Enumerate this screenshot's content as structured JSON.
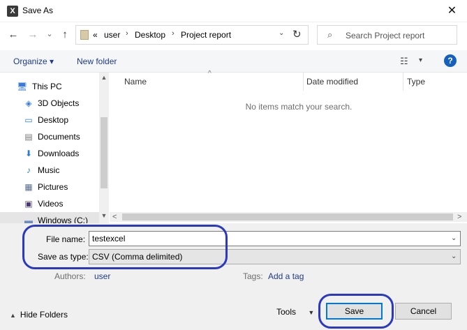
{
  "window": {
    "app_icon": "X",
    "title": "Save As",
    "close_glyph": "✕"
  },
  "nav": {
    "back": "←",
    "forward": "→",
    "recent": "⌄",
    "up": "↑",
    "address": {
      "overflow": "«",
      "segments": [
        "user",
        "Desktop",
        "Project report"
      ],
      "separator": "›",
      "dropdown": "⌄",
      "refresh": "↻"
    },
    "search_placeholder": "Search Project report",
    "search_glyph": "⌕"
  },
  "toolbar": {
    "organize": "Organize ▾",
    "new_folder": "New folder",
    "view_glyph": "☷",
    "view_dropdown": "▾",
    "help": "?"
  },
  "sidebar": {
    "items": [
      {
        "label": "This PC",
        "icon": "computer-icon",
        "glyph": "🖥",
        "indent": 0
      },
      {
        "label": "3D Objects",
        "icon": "cube-icon",
        "glyph": "◈",
        "indent": 1
      },
      {
        "label": "Desktop",
        "icon": "desktop-icon",
        "glyph": "▭",
        "indent": 1
      },
      {
        "label": "Documents",
        "icon": "document-icon",
        "glyph": "▤",
        "indent": 1
      },
      {
        "label": "Downloads",
        "icon": "download-icon",
        "glyph": "⬇",
        "indent": 1
      },
      {
        "label": "Music",
        "icon": "music-icon",
        "glyph": "♪",
        "indent": 1
      },
      {
        "label": "Pictures",
        "icon": "pictures-icon",
        "glyph": "▦",
        "indent": 1
      },
      {
        "label": "Videos",
        "icon": "video-icon",
        "glyph": "▣",
        "indent": 1
      },
      {
        "label": "Windows (C:)",
        "icon": "drive-icon",
        "glyph": "▬",
        "indent": 1
      }
    ],
    "scroll_up": "▲",
    "scroll_down": "▼"
  },
  "content": {
    "columns": [
      "Name",
      "Date modified",
      "Type"
    ],
    "sort_caret": "^",
    "empty_message": "No items match your search.",
    "scroll_left": "<",
    "scroll_right": ">"
  },
  "form": {
    "file_name_label": "File name:",
    "file_name_value": "testexcel",
    "save_type_label": "Save as type:",
    "save_type_value": "CSV (Comma delimited)",
    "dropdown_glyph": "⌄",
    "authors_label": "Authors:",
    "authors_value": "user",
    "tags_label": "Tags:",
    "tags_value": "Add a tag"
  },
  "footer": {
    "hide_folders": "Hide Folders",
    "hide_glyph": "▲",
    "tools": "Tools",
    "tools_dropdown": "▼",
    "save": "Save",
    "cancel": "Cancel"
  },
  "colors": {
    "annotation": "#2a39c0",
    "link_blue": "#1e3a8a",
    "primary_border": "#0078d7"
  }
}
